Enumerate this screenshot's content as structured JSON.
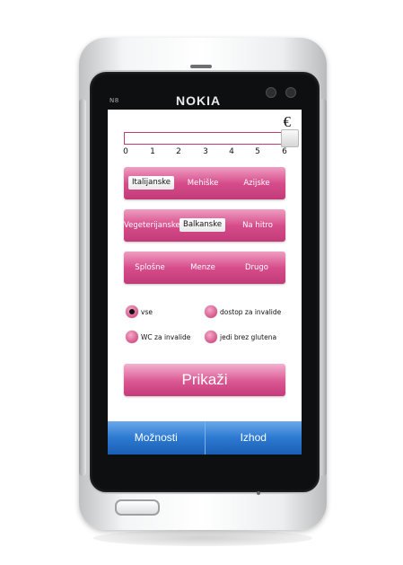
{
  "device": {
    "model": "N8",
    "brand": "NOKIA"
  },
  "price": {
    "currency_symbol": "€",
    "ticks": [
      "0",
      "1",
      "2",
      "3",
      "4",
      "5",
      "6"
    ],
    "value": 6
  },
  "cuisine_rows": [
    {
      "items": [
        {
          "label": "Italijanske",
          "selected": true
        },
        {
          "label": "Mehiške",
          "selected": false
        },
        {
          "label": "Azijske",
          "selected": false
        }
      ]
    },
    {
      "items": [
        {
          "label": "Vegeterijanske",
          "selected": false
        },
        {
          "label": "Balkanske",
          "selected": true
        },
        {
          "label": "Na hitro",
          "selected": false
        }
      ]
    },
    {
      "items": [
        {
          "label": "Splošne",
          "selected": false
        },
        {
          "label": "Menze",
          "selected": false
        },
        {
          "label": "Drugo",
          "selected": false
        }
      ]
    }
  ],
  "filters": [
    {
      "label": "vse",
      "checked": true
    },
    {
      "label": "dostop za invalide",
      "checked": false
    },
    {
      "label": "WC za invalide",
      "checked": false
    },
    {
      "label": "jedi brez glutena",
      "checked": false
    }
  ],
  "show_button": "Prikaži",
  "softkeys": {
    "left": "Možnosti",
    "right": "Izhod"
  },
  "colors": {
    "accent": "#d74d8b",
    "softkey": "#2c79d1"
  }
}
